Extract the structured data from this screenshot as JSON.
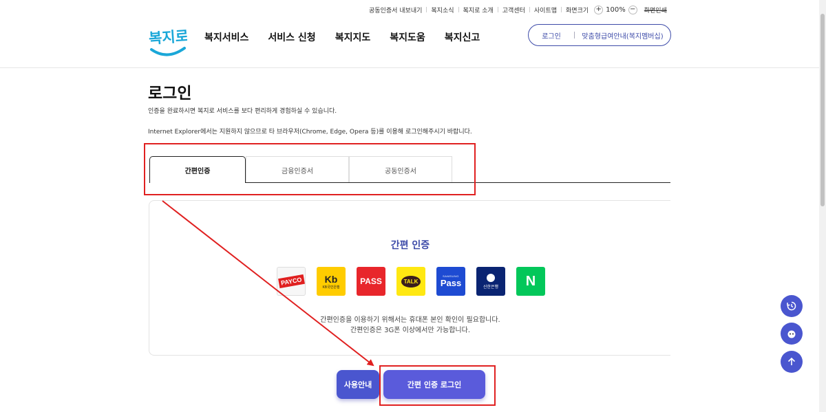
{
  "util_bar": {
    "links": [
      "공동인증서 내보내기",
      "복지소식",
      "복지로 소개",
      "고객센터",
      "사이트맵",
      "화면크기"
    ],
    "zoom_minus": "−",
    "zoom_plus": "+",
    "zoom_value": "100%",
    "print": "화면인쇄"
  },
  "header": {
    "logo_text": "복지로",
    "nav": [
      "복지서비스",
      "서비스 신청",
      "복지지도",
      "복지도움",
      "복지신고"
    ],
    "login": "로그인",
    "bokji_wallet": "맞춤형급여안내(복지멤버십)"
  },
  "page": {
    "title": "로그인",
    "desc1": "인증을 완료하시면 복지로 서비스를 보다 편리하게 경험하실 수 있습니다.",
    "desc2": "Internet Explorer에서는 지원하지 않으므로 타 브라우저(Chrome, Edge, Opera 등)를 이용해 로그인해주시기 바랍니다."
  },
  "tabs": [
    {
      "label": "간편인증",
      "active": true
    },
    {
      "label": "금융인증서",
      "active": false
    },
    {
      "label": "공동인증서",
      "active": false
    }
  ],
  "auth": {
    "title": "간편 인증",
    "providers": {
      "payco": "PAYCO",
      "kb": "Kb",
      "kb_sub": "KB국민은행",
      "pass": "PASS",
      "kakao": "TALK",
      "samsung_sub": "SAMSUNG",
      "samsung": "Pass",
      "shinhan": "신한은행",
      "naver": "N"
    },
    "note1": "간편인증을 이용하기 위해서는 휴대폰 본인 확인이 필요합니다.",
    "note2": "간편인증은 3G폰 이상에서만 가능합니다."
  },
  "buttons": {
    "guide": "사용안내",
    "login": "간편 인증 로그인"
  },
  "colors": {
    "accent": "#4a56cf",
    "annotation": "#e02020"
  }
}
